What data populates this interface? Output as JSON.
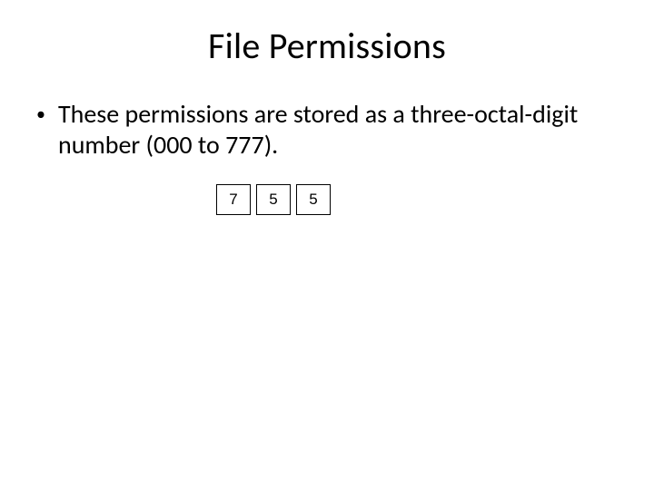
{
  "title": "File Permissions",
  "bullet_marker": "•",
  "bullet_text": "These permissions are stored as a three-octal-digit number (000 to 777).",
  "digits": {
    "d0": "7",
    "d1": "5",
    "d2": "5"
  }
}
